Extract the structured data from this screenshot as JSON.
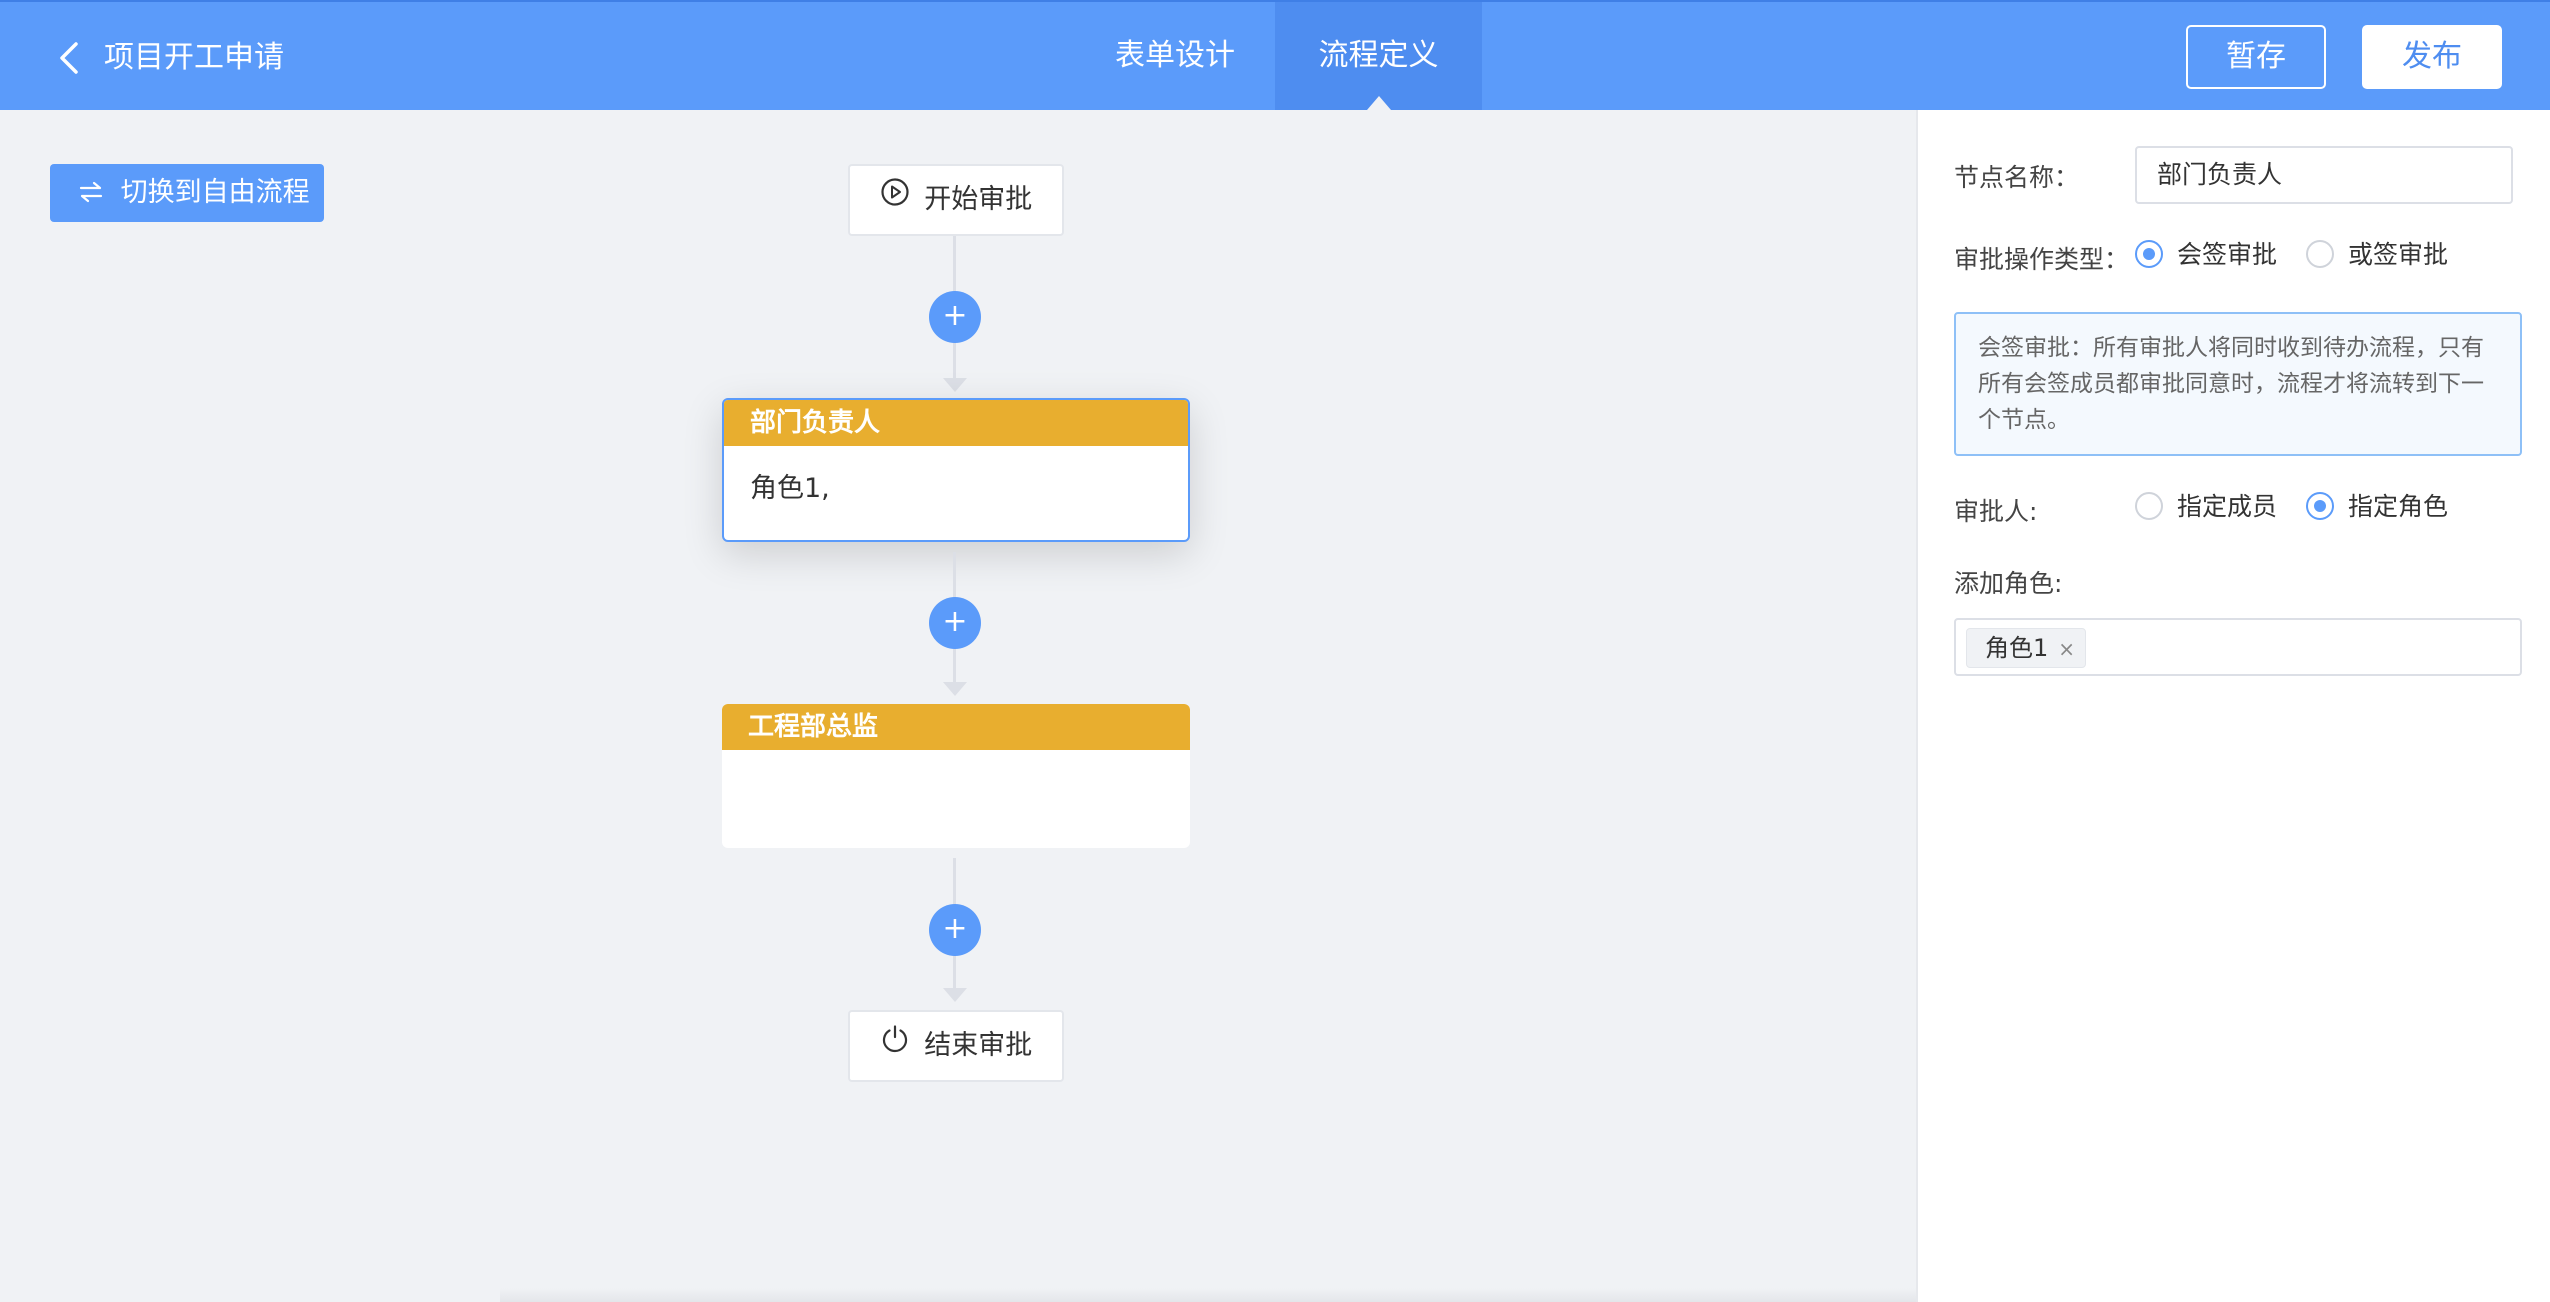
{
  "header": {
    "title": "项目开工申请",
    "tabs": [
      {
        "label": "表单设计",
        "active": false
      },
      {
        "label": "流程定义",
        "active": true
      }
    ],
    "save_label": "暂存",
    "publish_label": "发布"
  },
  "canvas": {
    "switch_label": "切换到自由流程",
    "start_node": "开始审批",
    "end_node": "结束审批",
    "add_symbol": "+",
    "approval_nodes": [
      {
        "title": "部门负责人",
        "content": "角色1,",
        "selected": true
      },
      {
        "title": "工程部总监",
        "content": "",
        "selected": false
      }
    ]
  },
  "panel": {
    "node_name_label": "节点名称：",
    "node_name_value": "部门负责人",
    "op_type_label": "审批操作类型：",
    "op_type_options": [
      {
        "label": "会签审批",
        "checked": true
      },
      {
        "label": "或签审批",
        "checked": false
      }
    ],
    "info_text": "会签审批：所有审批人将同时收到待办流程，只有所有会签成员都审批同意时，流程才将流转到下一个节点。",
    "approver_label": "审批人:",
    "approver_options": [
      {
        "label": "指定成员",
        "checked": false
      },
      {
        "label": "指定角色",
        "checked": true
      }
    ],
    "add_role_label": "添加角色:",
    "roles": [
      "角色1"
    ],
    "remove_symbol": "×"
  },
  "colors": {
    "header_bg": "#5b9bfa",
    "accent": "#5b9bfa",
    "node_header": "#e8ae2f"
  }
}
